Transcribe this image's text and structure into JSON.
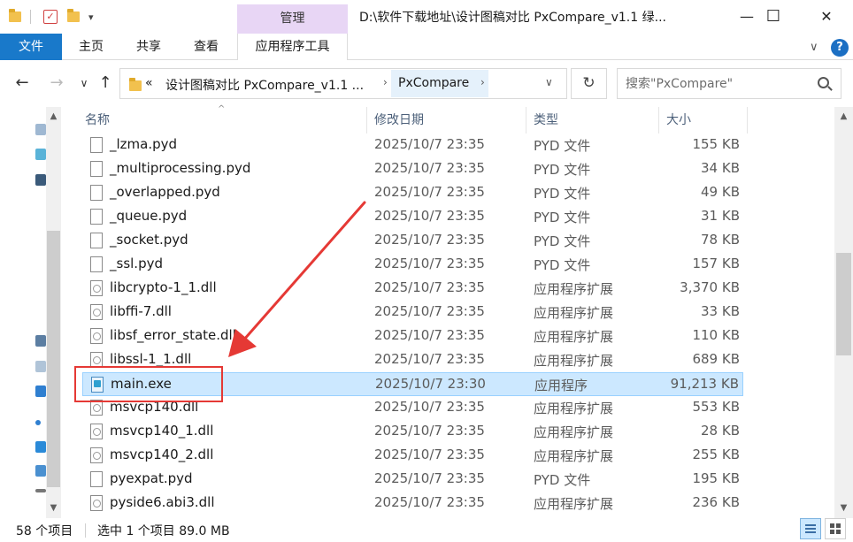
{
  "window": {
    "title": "D:\\软件下载地址\\设计图稿对比 PxCompare_v1.1 绿...",
    "context_tab": "管理",
    "minimize_glyph": "—",
    "maximize_glyph": "☐",
    "close_glyph": "✕"
  },
  "ribbon": {
    "tabs": [
      "文件",
      "主页",
      "共享",
      "查看",
      "应用程序工具"
    ],
    "help_glyph": "?",
    "collapse_glyph": "∨"
  },
  "address": {
    "back_glyph": "←",
    "forward_glyph": "→",
    "recent_glyph": "∨",
    "up_glyph": "↑",
    "overflow": "«",
    "crumbs": [
      "设计图稿对比 PxCompare_v1.1 ...",
      "PxCompare"
    ],
    "crumb_sep": "›",
    "dropdown_glyph": "∨",
    "refresh_glyph": "↻",
    "search_placeholder": "搜索\"PxCompare\""
  },
  "columns": {
    "name": "名称",
    "date": "修改日期",
    "type": "类型",
    "size": "大小",
    "sort_glyph": "^"
  },
  "files": [
    {
      "name": "_lzma.pyd",
      "date": "2025/10/7 23:35",
      "type": "PYD 文件",
      "size": "155 KB",
      "kind": "pyd",
      "selected": false
    },
    {
      "name": "_multiprocessing.pyd",
      "date": "2025/10/7 23:35",
      "type": "PYD 文件",
      "size": "34 KB",
      "kind": "pyd",
      "selected": false
    },
    {
      "name": "_overlapped.pyd",
      "date": "2025/10/7 23:35",
      "type": "PYD 文件",
      "size": "49 KB",
      "kind": "pyd",
      "selected": false
    },
    {
      "name": "_queue.pyd",
      "date": "2025/10/7 23:35",
      "type": "PYD 文件",
      "size": "31 KB",
      "kind": "pyd",
      "selected": false
    },
    {
      "name": "_socket.pyd",
      "date": "2025/10/7 23:35",
      "type": "PYD 文件",
      "size": "78 KB",
      "kind": "pyd",
      "selected": false
    },
    {
      "name": "_ssl.pyd",
      "date": "2025/10/7 23:35",
      "type": "PYD 文件",
      "size": "157 KB",
      "kind": "pyd",
      "selected": false
    },
    {
      "name": "libcrypto-1_1.dll",
      "date": "2025/10/7 23:35",
      "type": "应用程序扩展",
      "size": "3,370 KB",
      "kind": "dll",
      "selected": false
    },
    {
      "name": "libffi-7.dll",
      "date": "2025/10/7 23:35",
      "type": "应用程序扩展",
      "size": "33 KB",
      "kind": "dll",
      "selected": false
    },
    {
      "name": "libsf_error_state.dll",
      "date": "2025/10/7 23:35",
      "type": "应用程序扩展",
      "size": "110 KB",
      "kind": "dll",
      "selected": false
    },
    {
      "name": "libssl-1_1.dll",
      "date": "2025/10/7 23:35",
      "type": "应用程序扩展",
      "size": "689 KB",
      "kind": "dll",
      "selected": false
    },
    {
      "name": "main.exe",
      "date": "2025/10/7 23:30",
      "type": "应用程序",
      "size": "91,213 KB",
      "kind": "exe",
      "selected": true
    },
    {
      "name": "msvcp140.dll",
      "date": "2025/10/7 23:35",
      "type": "应用程序扩展",
      "size": "553 KB",
      "kind": "dll",
      "selected": false
    },
    {
      "name": "msvcp140_1.dll",
      "date": "2025/10/7 23:35",
      "type": "应用程序扩展",
      "size": "28 KB",
      "kind": "dll",
      "selected": false
    },
    {
      "name": "msvcp140_2.dll",
      "date": "2025/10/7 23:35",
      "type": "应用程序扩展",
      "size": "255 KB",
      "kind": "dll",
      "selected": false
    },
    {
      "name": "pyexpat.pyd",
      "date": "2025/10/7 23:35",
      "type": "PYD 文件",
      "size": "195 KB",
      "kind": "pyd",
      "selected": false
    },
    {
      "name": "pyside6.abi3.dll",
      "date": "2025/10/7 23:35",
      "type": "应用程序扩展",
      "size": "236 KB",
      "kind": "dll",
      "selected": false
    }
  ],
  "status": {
    "item_count": "58 个项目",
    "selection": "选中 1 个项目  89.0 MB"
  },
  "colors": {
    "accent": "#1979ca",
    "manage_tab_bg": "#e8d6f5",
    "selection_bg": "#cce8ff",
    "annotation_red": "#e53935"
  }
}
